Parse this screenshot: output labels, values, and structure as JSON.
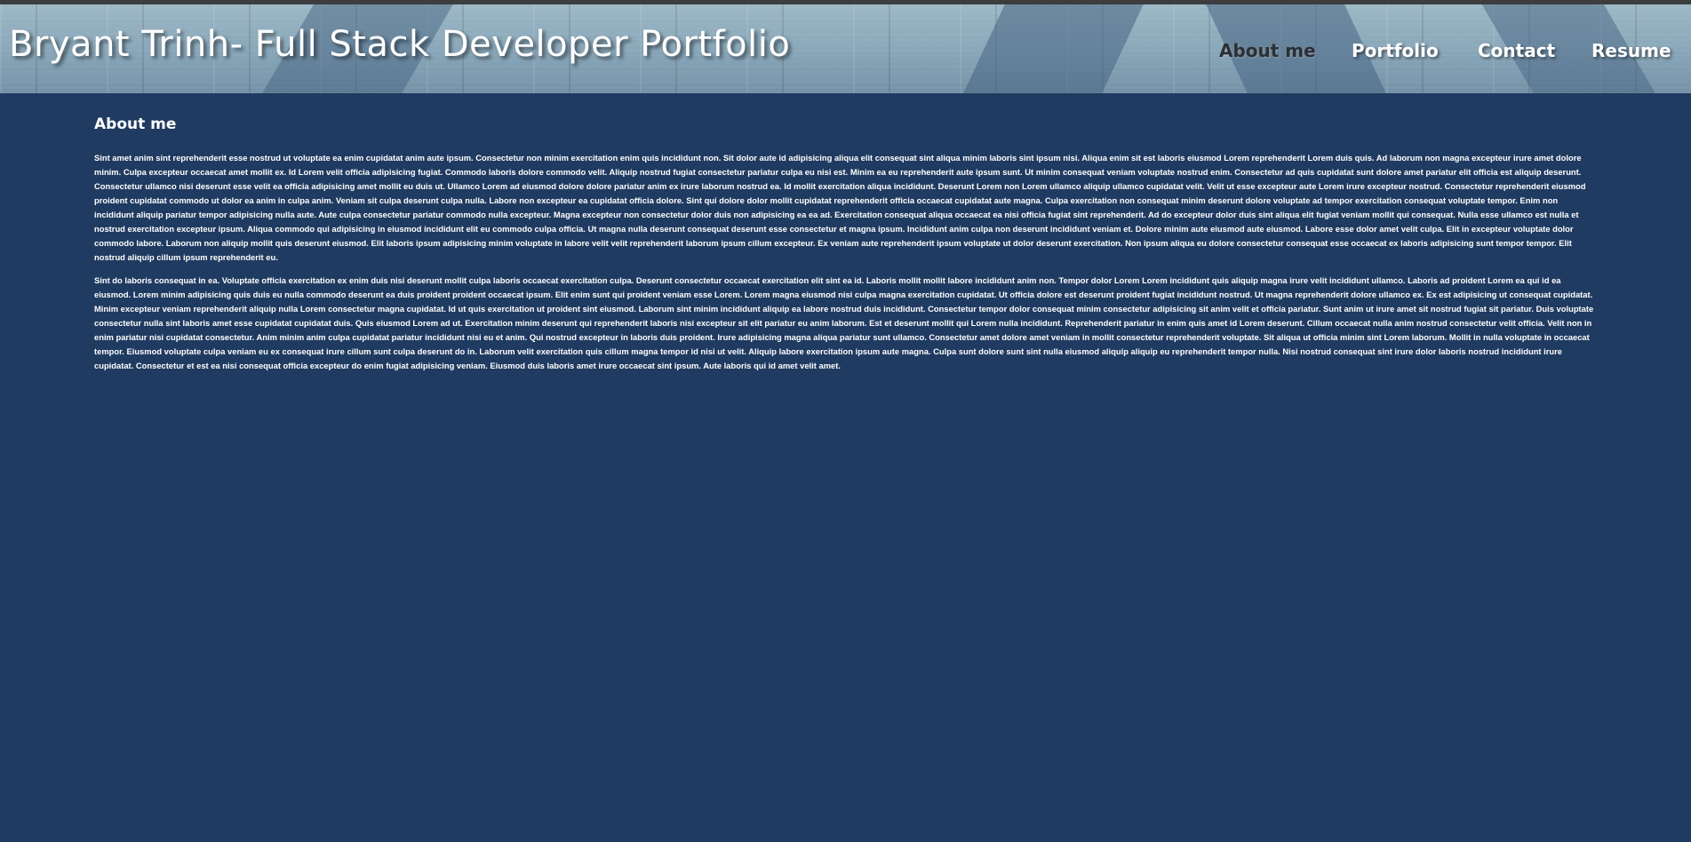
{
  "header": {
    "title": "Bryant Trinh- Full Stack Developer Portfolio"
  },
  "nav": {
    "items": [
      {
        "label": "About me",
        "active": true
      },
      {
        "label": "Portfolio",
        "active": false
      },
      {
        "label": "Contact",
        "active": false
      },
      {
        "label": "Resume",
        "active": false
      }
    ]
  },
  "main": {
    "heading": "About me",
    "paragraphs": [
      "Sint amet anim sint reprehenderit esse nostrud ut voluptate ea enim cupidatat anim aute ipsum. Consectetur non minim exercitation enim quis incididunt non. Sit dolor aute id adipisicing aliqua elit consequat sint aliqua minim laboris sint ipsum nisi. Aliqua enim sit est laboris eiusmod Lorem reprehenderit Lorem duis quis. Ad laborum non magna excepteur irure amet dolore minim. Culpa excepteur occaecat amet mollit ex. Id Lorem velit officia adipisicing fugiat. Commodo laboris dolore commodo velit. Aliquip nostrud fugiat consectetur pariatur culpa eu nisi est. Minim ea eu reprehenderit aute ipsum sunt. Ut minim consequat veniam voluptate nostrud enim. Consectetur ad quis cupidatat sunt dolore amet pariatur elit officia est aliquip deserunt. Consectetur ullamco nisi deserunt esse velit ea officia adipisicing amet mollit eu duis ut. Ullamco Lorem ad eiusmod dolore dolore pariatur anim ex irure laborum nostrud ea. Id mollit exercitation aliqua incididunt. Deserunt Lorem non Lorem ullamco aliquip ullamco cupidatat velit. Velit ut esse excepteur aute Lorem irure excepteur nostrud. Consectetur reprehenderit eiusmod proident cupidatat commodo ut dolor ea anim in culpa anim. Veniam sit culpa deserunt culpa nulla. Labore non excepteur ea cupidatat officia dolore. Sint qui dolore dolor mollit cupidatat reprehenderit officia occaecat cupidatat aute magna. Culpa exercitation non consequat minim deserunt dolore voluptate ad tempor exercitation consequat voluptate tempor. Enim non incididunt aliquip pariatur tempor adipisicing nulla aute. Aute culpa consectetur pariatur commodo nulla excepteur. Magna excepteur non consectetur dolor duis non adipisicing ea ea ad. Exercitation consequat aliqua occaecat ea nisi officia fugiat sint reprehenderit. Ad do excepteur dolor duis sint aliqua elit fugiat veniam mollit qui consequat. Nulla esse ullamco est nulla et nostrud exercitation excepteur ipsum. Aliqua commodo qui adipisicing in eiusmod incididunt elit eu commodo culpa officia. Ut magna nulla deserunt consequat deserunt esse consectetur et magna ipsum. Incididunt anim culpa non deserunt incididunt veniam et. Dolore minim aute eiusmod aute eiusmod. Labore esse dolor amet velit culpa. Elit in excepteur voluptate dolor commodo labore. Laborum non aliquip mollit quis deserunt eiusmod. Elit laboris ipsum adipisicing minim voluptate in labore velit velit reprehenderit laborum ipsum cillum excepteur. Ex veniam aute reprehenderit ipsum voluptate ut dolor deserunt exercitation. Non ipsum aliqua eu dolore consectetur consequat esse occaecat ex laboris adipisicing sunt tempor tempor. Elit nostrud aliquip cillum ipsum reprehenderit eu.",
      "Sint do laboris consequat in ea. Voluptate officia exercitation ex enim duis nisi deserunt mollit culpa laboris occaecat exercitation culpa. Deserunt consectetur occaecat exercitation elit sint ea id. Laboris mollit mollit labore incididunt anim non. Tempor dolor Lorem Lorem incididunt quis aliquip magna irure velit incididunt ullamco. Laboris ad proident Lorem ea qui id ea eiusmod. Lorem minim adipisicing quis duis eu nulla commodo deserunt ea duis proident proident occaecat ipsum. Elit enim sunt qui proident veniam esse Lorem. Lorem magna eiusmod nisi culpa magna exercitation cupidatat. Ut officia dolore est deserunt proident fugiat incididunt nostrud. Ut magna reprehenderit dolore ullamco ex. Ex est adipisicing ut consequat cupidatat. Minim excepteur veniam reprehenderit aliquip nulla Lorem consectetur magna cupidatat. Id ut quis exercitation ut proident sint eiusmod. Laborum sint minim incididunt aliquip ea labore nostrud duis incididunt. Consectetur tempor dolor consequat minim consectetur adipisicing sit anim velit et officia pariatur. Sunt anim ut irure amet sit nostrud fugiat sit pariatur. Duis voluptate consectetur nulla sint laboris amet esse cupidatat cupidatat duis. Quis eiusmod Lorem ad ut. Exercitation minim deserunt qui reprehenderit laboris nisi excepteur sit elit pariatur eu anim laborum. Est et deserunt mollit qui Lorem nulla incididunt. Reprehenderit pariatur in enim quis amet id Lorem deserunt. Cillum occaecat nulla anim nostrud consectetur velit officia. Velit non in enim pariatur nisi cupidatat consectetur. Anim minim anim culpa cupidatat pariatur incididunt nisi eu et anim. Qui nostrud excepteur in laboris duis proident. Irure adipisicing magna aliqua pariatur sunt ullamco. Consectetur amet dolore amet veniam in mollit consectetur reprehenderit voluptate. Sit aliqua ut officia minim sint Lorem laborum. Mollit in nulla voluptate in occaecat tempor. Eiusmod voluptate culpa veniam eu ex consequat irure cillum sunt culpa deserunt do in. Laborum velit exercitation quis cillum magna tempor id nisi ut velit. Aliquip labore exercitation ipsum aute magna. Culpa sunt dolore sunt sint nulla eiusmod aliquip aliquip eu reprehenderit tempor nulla. Nisi nostrud consequat sint irure dolor laboris nostrud incididunt irure cupidatat. Consectetur et est ea nisi consequat officia excepteur do enim fugiat adipisicing veniam. Eiusmod duis laboris amet irure occaecat sint ipsum. Aute laboris qui id amet velit amet."
    ]
  },
  "colors": {
    "page_background": "#203b61",
    "top_strip": "#3d3d3f",
    "text": "#ffffff",
    "active_nav": "#2c2f33"
  }
}
